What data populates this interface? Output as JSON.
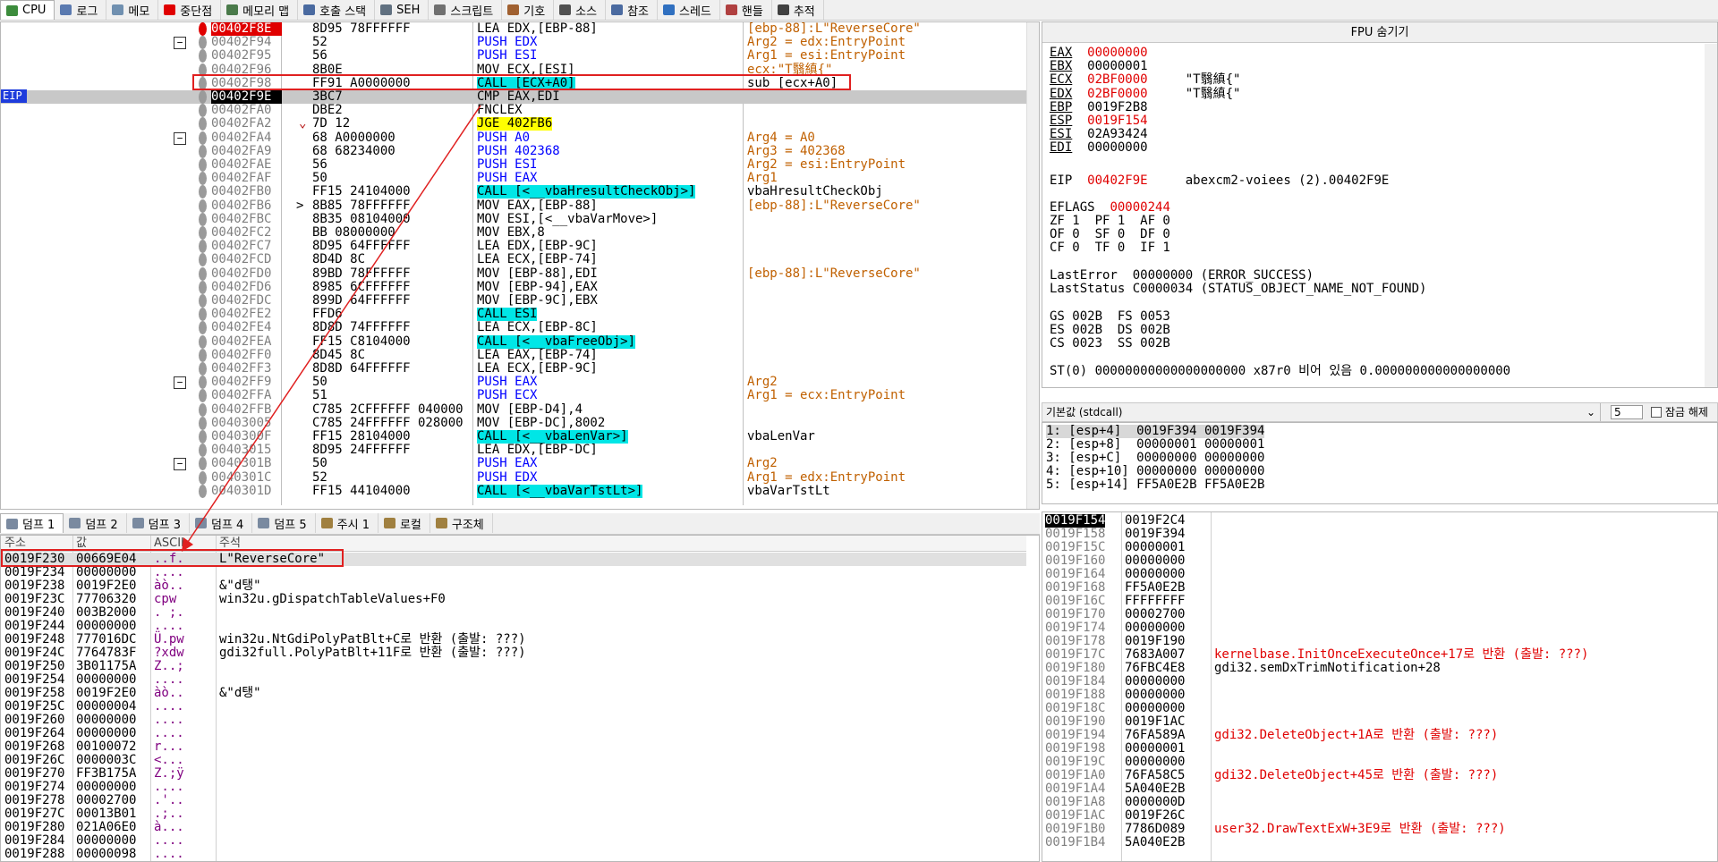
{
  "tabs": [
    {
      "label": "CPU",
      "color": "#3c8c3c"
    },
    {
      "label": "로그",
      "color": "#5a7ab0"
    },
    {
      "label": "메모",
      "color": "#7090b0"
    },
    {
      "label": "중단점",
      "color": "#e00000"
    },
    {
      "label": "메모리 맵",
      "color": "#4a7a4a"
    },
    {
      "label": "호출 스택",
      "color": "#4a6aa0"
    },
    {
      "label": "SEH",
      "color": "#607080"
    },
    {
      "label": "스크립트",
      "color": "#707070"
    },
    {
      "label": "기호",
      "color": "#a06030"
    },
    {
      "label": "소스",
      "color": "#505050"
    },
    {
      "label": "참조",
      "color": "#4a6aa0"
    },
    {
      "label": "스레드",
      "color": "#3070c0"
    },
    {
      "label": "핸들",
      "color": "#b04040"
    },
    {
      "label": "추적",
      "color": "#404040"
    }
  ],
  "cpu": {
    "eip_tag": "EIP",
    "rows": [
      {
        "addr": "00402F8E",
        "bytes": "8D95 78FFFFFF",
        "dis": "LEA EDX,[EBP-88]",
        "com": "[ebp-88]:L\"ReverseCore\"",
        "bp": "red"
      },
      {
        "addr": "00402F94",
        "bytes": "52",
        "dis": "PUSH EDX",
        "com": "Arg2 = edx:EntryPoint"
      },
      {
        "addr": "00402F95",
        "bytes": "56",
        "dis": "PUSH ESI",
        "com": "Arg1 = esi:EntryPoint"
      },
      {
        "addr": "00402F96",
        "bytes": "8B0E",
        "dis": "MOV ECX,[ESI]",
        "com": "ecx:\"T翳縝{\""
      },
      {
        "addr": "00402F98",
        "bytes": "FF91 A0000000",
        "dis": "CALL [ECX+A0]",
        "com": "sub_[ecx+A0]"
      },
      {
        "addr": "00402F9E",
        "bytes": "3BC7",
        "dis": "CMP EAX,EDI",
        "com": ""
      },
      {
        "addr": "00402FA0",
        "bytes": "DBE2",
        "dis": "FNCLEX",
        "com": ""
      },
      {
        "addr": "00402FA2",
        "bytes": "7D 12",
        "dis": "JGE 402FB6",
        "com": ""
      },
      {
        "addr": "00402FA4",
        "bytes": "68 A0000000",
        "dis": "PUSH A0",
        "com": "Arg4 = A0"
      },
      {
        "addr": "00402FA9",
        "bytes": "68 68234000",
        "dis": "PUSH 402368",
        "com": "Arg3 = 402368"
      },
      {
        "addr": "00402FAE",
        "bytes": "56",
        "dis": "PUSH ESI",
        "com": "Arg2 = esi:EntryPoint"
      },
      {
        "addr": "00402FAF",
        "bytes": "50",
        "dis": "PUSH EAX",
        "com": "Arg1"
      },
      {
        "addr": "00402FB0",
        "bytes": "FF15 24104000",
        "dis": "CALL [<__vbaHresultCheckObj>]",
        "com": "vbaHresultCheckObj"
      },
      {
        "addr": "00402FB6",
        "bytes": "8B85 78FFFFFF",
        "dis": "MOV EAX,[EBP-88]",
        "com": "[ebp-88]:L\"ReverseCore\""
      },
      {
        "addr": "00402FBC",
        "bytes": "8B35 08104000",
        "dis": "MOV ESI,[<__vbaVarMove>]",
        "com": ""
      },
      {
        "addr": "00402FC2",
        "bytes": "BB 08000000",
        "dis": "MOV EBX,8",
        "com": ""
      },
      {
        "addr": "00402FC7",
        "bytes": "8D95 64FFFFFF",
        "dis": "LEA EDX,[EBP-9C]",
        "com": ""
      },
      {
        "addr": "00402FCD",
        "bytes": "8D4D 8C",
        "dis": "LEA ECX,[EBP-74]",
        "com": ""
      },
      {
        "addr": "00402FD0",
        "bytes": "89BD 78FFFFFF",
        "dis": "MOV [EBP-88],EDI",
        "com": "[ebp-88]:L\"ReverseCore\""
      },
      {
        "addr": "00402FD6",
        "bytes": "8985 6CFFFFFF",
        "dis": "MOV [EBP-94],EAX",
        "com": ""
      },
      {
        "addr": "00402FDC",
        "bytes": "899D 64FFFFFF",
        "dis": "MOV [EBP-9C],EBX",
        "com": ""
      },
      {
        "addr": "00402FE2",
        "bytes": "FFD6",
        "dis": "CALL ESI",
        "com": ""
      },
      {
        "addr": "00402FE4",
        "bytes": "8D8D 74FFFFFF",
        "dis": "LEA ECX,[EBP-8C]",
        "com": ""
      },
      {
        "addr": "00402FEA",
        "bytes": "FF15 C8104000",
        "dis": "CALL [<__vbaFreeObj>]",
        "com": ""
      },
      {
        "addr": "00402FF0",
        "bytes": "8D45 8C",
        "dis": "LEA EAX,[EBP-74]",
        "com": ""
      },
      {
        "addr": "00402FF3",
        "bytes": "8D8D 64FFFFFF",
        "dis": "LEA ECX,[EBP-9C]",
        "com": ""
      },
      {
        "addr": "00402FF9",
        "bytes": "50",
        "dis": "PUSH EAX",
        "com": "Arg2"
      },
      {
        "addr": "00402FFA",
        "bytes": "51",
        "dis": "PUSH ECX",
        "com": "Arg1 = ecx:EntryPoint"
      },
      {
        "addr": "00402FFB",
        "bytes": "C785 2CFFFFFF 040000",
        "dis": "MOV [EBP-D4],4",
        "com": ""
      },
      {
        "addr": "00403005",
        "bytes": "C785 24FFFFFF 028000",
        "dis": "MOV [EBP-DC],8002",
        "com": ""
      },
      {
        "addr": "0040300F",
        "bytes": "FF15 28104000",
        "dis": "CALL [<__vbaLenVar>]",
        "com": "vbaLenVar"
      },
      {
        "addr": "00403015",
        "bytes": "8D95 24FFFFFF",
        "dis": "LEA EDX,[EBP-DC]",
        "com": ""
      },
      {
        "addr": "0040301B",
        "bytes": "50",
        "dis": "PUSH EAX",
        "com": "Arg2"
      },
      {
        "addr": "0040301C",
        "bytes": "52",
        "dis": "PUSH EDX",
        "com": "Arg1 = edx:EntryPoint"
      },
      {
        "addr": "0040301D",
        "bytes": "FF15 44104000",
        "dis": "CALL [<__vbaVarTstLt>]",
        "com": "vbaVarTstLt"
      }
    ]
  },
  "fpu": {
    "title": "FPU 숨기기",
    "regs": [
      {
        "name": "EAX",
        "value": "00000000",
        "note": "",
        "red": true
      },
      {
        "name": "EBX",
        "value": "00000001",
        "note": "",
        "red": false
      },
      {
        "name": "ECX",
        "value": "02BF0000",
        "note": "\"T翳縝{\"",
        "red": true
      },
      {
        "name": "EDX",
        "value": "02BF0000",
        "note": "\"T翳縝{\"",
        "red": true
      },
      {
        "name": "EBP",
        "value": "0019F2B8",
        "note": "",
        "red": false
      },
      {
        "name": "ESP",
        "value": "0019F154",
        "note": "",
        "red": true
      },
      {
        "name": "ESI",
        "value": "02A93424",
        "note": "",
        "red": false
      },
      {
        "name": "EDI",
        "value": "00000000",
        "note": "",
        "red": false
      }
    ],
    "eip": {
      "name": "EIP",
      "value": "00402F9E",
      "note": "abexcm2-voiees (2).00402F9E"
    },
    "eflags": {
      "name": "EFLAGS",
      "value": "00000244"
    },
    "flags1": "ZF 1  PF 1  AF 0",
    "flags2": "OF 0  SF 0  DF 0",
    "flags3": "CF 0  TF 0  IF 1",
    "lasterror": "LastError  00000000 (ERROR_SUCCESS)",
    "laststatus": "LastStatus C0000034 (STATUS_OBJECT_NAME_NOT_FOUND)",
    "seg1": "GS 002B  FS 0053",
    "seg2": "ES 002B  DS 002B",
    "seg3": "CS 0023  SS 002B",
    "st0": "ST(0) 00000000000000000000 x87r0 비어 있음 0.000000000000000000"
  },
  "callconv": {
    "label": "기본값 (stdcall)",
    "count": "5",
    "unlock": "잠금 해제됨"
  },
  "args": [
    "1: [esp+4]  0019F394 0019F394",
    "2: [esp+8]  00000001 00000001",
    "3: [esp+C]  00000000 00000000",
    "4: [esp+10] 00000000 00000000",
    "5: [esp+14] FF5A0E2B FF5A0E2B"
  ],
  "dump_tabs": [
    "덤프 1",
    "덤프 2",
    "덤프 3",
    "덤프 4",
    "덤프 5",
    "주시 1",
    "로컬",
    "구조체"
  ],
  "dump": {
    "headers": {
      "addr": "주소",
      "val": "값",
      "ascii": "ASCII",
      "com": "주석"
    },
    "rows": [
      {
        "a": "0019F230",
        "v": "00669E04",
        "s": "..f.",
        "c": "L\"ReverseCore\""
      },
      {
        "a": "0019F234",
        "v": "00000000",
        "s": "....",
        "c": ""
      },
      {
        "a": "0019F238",
        "v": "0019F2E0",
        "s": "àò..",
        "c": "&\"d탱\""
      },
      {
        "a": "0019F23C",
        "v": "77706320",
        "s": " cpw",
        "c": "win32u.gDispatchTableValues+F0"
      },
      {
        "a": "0019F240",
        "v": "003B2000",
        "s": ". ;.",
        "c": ""
      },
      {
        "a": "0019F244",
        "v": "00000000",
        "s": "....",
        "c": ""
      },
      {
        "a": "0019F248",
        "v": "777016DC",
        "s": "Ü.pw",
        "c": "win32u.NtGdiPolyPatBlt+C로 반환 (출발: ???)"
      },
      {
        "a": "0019F24C",
        "v": "7764783F",
        "s": "?xdw",
        "c": "gdi32full.PolyPatBlt+11F로 반환 (출발: ???)"
      },
      {
        "a": "0019F250",
        "v": "3B01175A",
        "s": "Z..;",
        "c": ""
      },
      {
        "a": "0019F254",
        "v": "00000000",
        "s": "....",
        "c": ""
      },
      {
        "a": "0019F258",
        "v": "0019F2E0",
        "s": "àò..",
        "c": "&\"d탱\""
      },
      {
        "a": "0019F25C",
        "v": "00000004",
        "s": "....",
        "c": ""
      },
      {
        "a": "0019F260",
        "v": "00000000",
        "s": "....",
        "c": ""
      },
      {
        "a": "0019F264",
        "v": "00000000",
        "s": "....",
        "c": ""
      },
      {
        "a": "0019F268",
        "v": "00100072",
        "s": "r...",
        "c": ""
      },
      {
        "a": "0019F26C",
        "v": "0000003C",
        "s": "<...",
        "c": ""
      },
      {
        "a": "0019F270",
        "v": "FF3B175A",
        "s": "Z.;ÿ",
        "c": ""
      },
      {
        "a": "0019F274",
        "v": "00000000",
        "s": "....",
        "c": ""
      },
      {
        "a": "0019F278",
        "v": "00002700",
        "s": ".'..",
        "c": ""
      },
      {
        "a": "0019F27C",
        "v": "00013B01",
        "s": ".;..",
        "c": ""
      },
      {
        "a": "0019F280",
        "v": "021A06E0",
        "s": "à...",
        "c": ""
      },
      {
        "a": "0019F284",
        "v": "00000000",
        "s": "....",
        "c": ""
      },
      {
        "a": "0019F288",
        "v": "00000098",
        "s": "....",
        "c": ""
      }
    ]
  },
  "stack": [
    {
      "a": "0019F154",
      "v": "0019F2C4",
      "c": "",
      "red": false,
      "cur": true
    },
    {
      "a": "0019F158",
      "v": "0019F394",
      "c": "",
      "red": false
    },
    {
      "a": "0019F15C",
      "v": "00000001",
      "c": "",
      "red": false
    },
    {
      "a": "0019F160",
      "v": "00000000",
      "c": "",
      "red": false
    },
    {
      "a": "0019F164",
      "v": "00000000",
      "c": "",
      "red": false
    },
    {
      "a": "0019F168",
      "v": "FF5A0E2B",
      "c": "",
      "red": false
    },
    {
      "a": "0019F16C",
      "v": "FFFFFFFF",
      "c": "",
      "red": false
    },
    {
      "a": "0019F170",
      "v": "00002700",
      "c": "",
      "red": false
    },
    {
      "a": "0019F174",
      "v": "00000000",
      "c": "",
      "red": false
    },
    {
      "a": "0019F178",
      "v": "0019F190",
      "c": "",
      "red": false
    },
    {
      "a": "0019F17C",
      "v": "7683A007",
      "c": "kernelbase.InitOnceExecuteOnce+17로 반환 (출발: ???)",
      "red": true
    },
    {
      "a": "0019F180",
      "v": "76FBC4E8",
      "c": "gdi32.semDxTrimNotification+28",
      "red": false
    },
    {
      "a": "0019F184",
      "v": "00000000",
      "c": "",
      "red": false
    },
    {
      "a": "0019F188",
      "v": "00000000",
      "c": "",
      "red": false
    },
    {
      "a": "0019F18C",
      "v": "00000000",
      "c": "",
      "red": false
    },
    {
      "a": "0019F190",
      "v": "0019F1AC",
      "c": "",
      "red": false
    },
    {
      "a": "0019F194",
      "v": "76FA589A",
      "c": "gdi32.DeleteObject+1A로 반환 (출발: ???)",
      "red": true
    },
    {
      "a": "0019F198",
      "v": "00000001",
      "c": "",
      "red": false
    },
    {
      "a": "0019F19C",
      "v": "00000000",
      "c": "",
      "red": false
    },
    {
      "a": "0019F1A0",
      "v": "76FA58C5",
      "c": "gdi32.DeleteObject+45로 반환 (출발: ???)",
      "red": true
    },
    {
      "a": "0019F1A4",
      "v": "5A040E2B",
      "c": "",
      "red": false
    },
    {
      "a": "0019F1A8",
      "v": "0000000D",
      "c": "",
      "red": false
    },
    {
      "a": "0019F1AC",
      "v": "0019F26C",
      "c": "",
      "red": false
    },
    {
      "a": "0019F1B0",
      "v": "7786D089",
      "c": "user32.DrawTextExW+3E9로 반환 (출발: ???)",
      "red": true
    },
    {
      "a": "0019F1B4",
      "v": "5A040E2B",
      "c": "",
      "red": false
    }
  ],
  "colors": {
    "accent_red": "#e00000",
    "eip_blue": "#1e3cdc",
    "call_cyan": "#00e6e6",
    "jump_yellow": "#ffff00"
  }
}
